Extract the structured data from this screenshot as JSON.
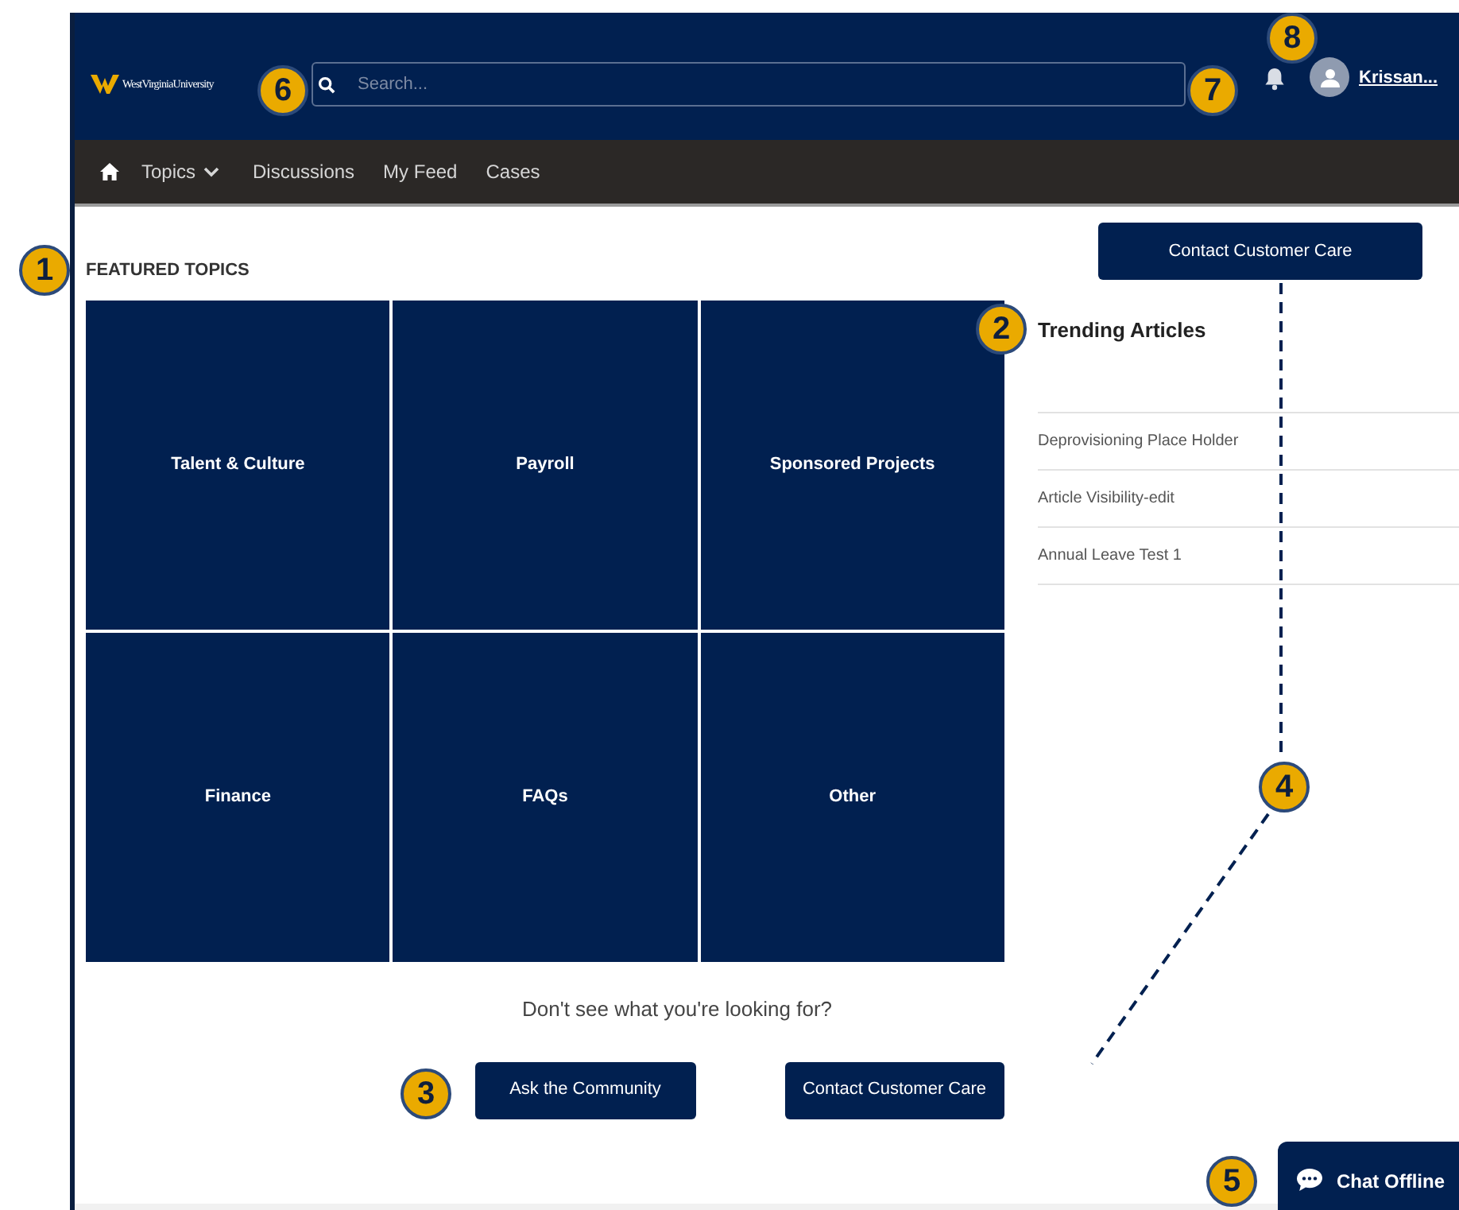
{
  "header": {
    "logo": "WestVirginiaUniversity",
    "search": {
      "placeholder": "Search..."
    },
    "user": {
      "name": "Krissan..."
    }
  },
  "nav": [
    {
      "kind": "home"
    },
    {
      "kind": "dropdown",
      "label": "Topics"
    },
    {
      "kind": "link",
      "label": "Discussions"
    },
    {
      "kind": "link",
      "label": "My Feed"
    },
    {
      "kind": "link",
      "label": "Cases"
    }
  ],
  "featured": {
    "title": "FEATURED TOPICS",
    "tiles": [
      "Talent & Culture",
      "Payroll",
      "Sponsored Projects",
      "Finance",
      "FAQs",
      "Other"
    ]
  },
  "contact_top": "Contact Customer Care",
  "trending": {
    "title": "Trending Articles",
    "articles": [
      "Deprovisioning Place Holder",
      "Article Visibility-edit",
      "Annual Leave Test 1"
    ]
  },
  "prompt": "Don't see what you're looking for?",
  "buttons": [
    "Ask the Community",
    "Contact Customer Care"
  ],
  "chat": "Chat Offline",
  "callouts": [
    "1",
    "2",
    "3",
    "4",
    "5",
    "6",
    "7",
    "8"
  ]
}
